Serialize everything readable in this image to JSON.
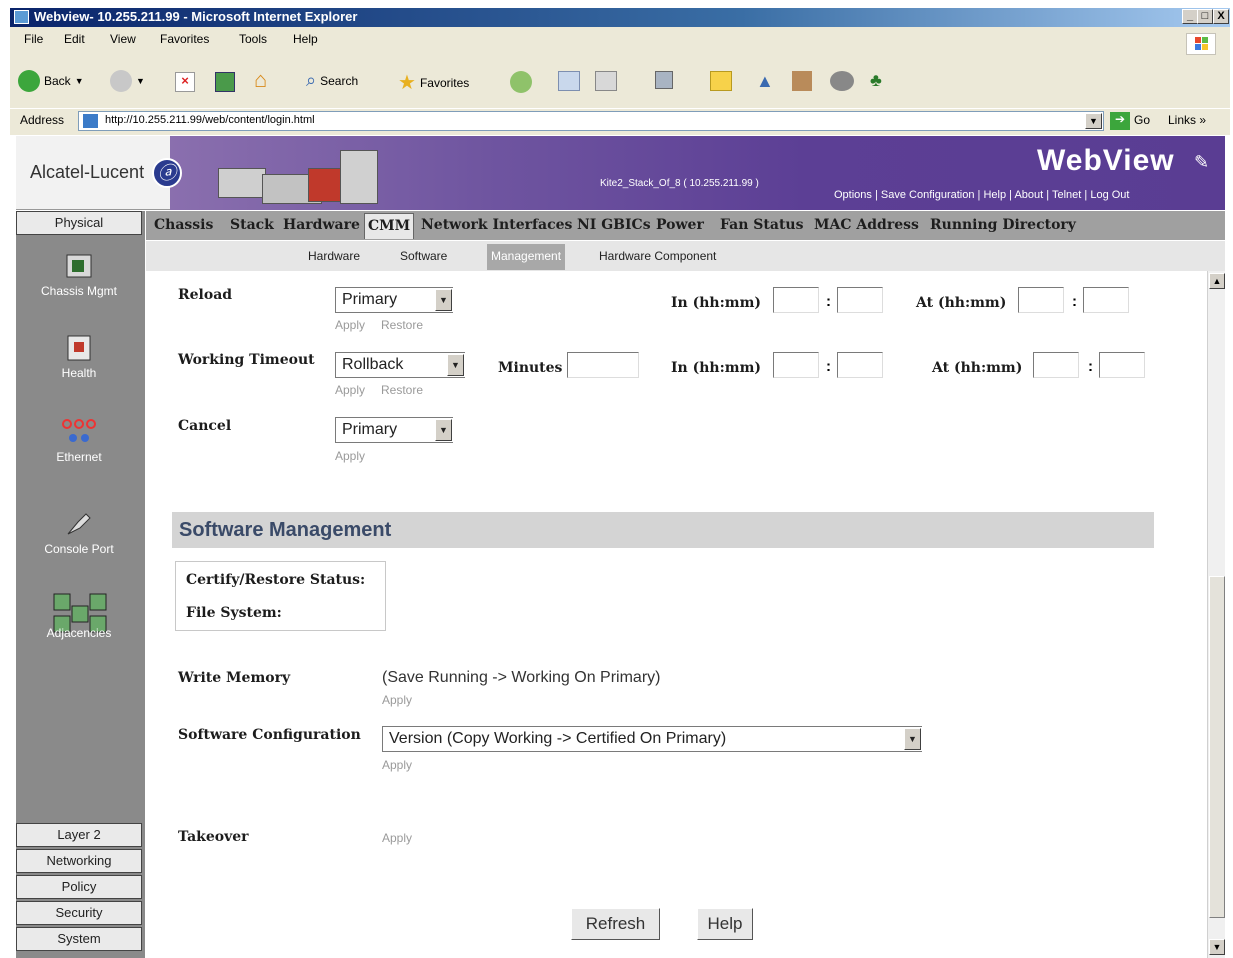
{
  "window": {
    "title": "Webview- 10.255.211.99 - Microsoft Internet Explorer",
    "min": "_",
    "max": "□",
    "close": "X"
  },
  "menu": [
    "File",
    "Edit",
    "View",
    "Favorites",
    "Tools",
    "Help"
  ],
  "toolbar": {
    "back": "Back",
    "search": "Search",
    "favorites": "Favorites"
  },
  "address": {
    "label": "Address",
    "url": "http://10.255.211.99/web/content/login.html",
    "go": "Go",
    "links": "Links »"
  },
  "header": {
    "brand": "Alcatel-Lucent",
    "system_name": "Kite2_Stack_Of_8  ( 10.255.211.99 )",
    "product_title": "WebView",
    "links": [
      "Options",
      "Save Configuration",
      "Help",
      "About",
      "Telnet",
      "Log Out"
    ]
  },
  "tabs": [
    "Chassis",
    "Stack",
    "Hardware",
    "CMM",
    "Network Interfaces",
    "NI GBICs",
    "Power",
    "Fan Status",
    "MAC Address",
    "Running Directory"
  ],
  "subtabs": [
    "Hardware",
    "Software",
    "Management",
    "Hardware Component"
  ],
  "leftnav": {
    "top_header": "Physical",
    "items": [
      "Chassis Mgmt",
      "Health",
      "Ethernet",
      "Console Port",
      "Adjacencies"
    ],
    "bottom_headers": [
      "Layer 2",
      "Networking",
      "Policy",
      "Security",
      "System"
    ]
  },
  "form": {
    "reload": {
      "label": "Reload",
      "select": "Primary",
      "apply": "Apply",
      "restore": "Restore",
      "in_label": "In (hh:mm)",
      "at_label": "At (hh:mm)"
    },
    "working_timeout": {
      "label": "Working Timeout",
      "select": "Rollback",
      "apply": "Apply",
      "restore": "Restore",
      "minutes_label": "Minutes",
      "in_label": "In (hh:mm)",
      "at_label": "At (hh:mm)"
    },
    "cancel": {
      "label": "Cancel",
      "select": "Primary",
      "apply": "Apply"
    },
    "colon": ":"
  },
  "software_management": {
    "title": "Software Management",
    "certify_status_label": "Certify/Restore Status:",
    "file_system_label": "File System:",
    "write_memory": {
      "label": "Write Memory",
      "desc": "(Save Running -> Working On Primary)",
      "apply": "Apply"
    },
    "software_configuration": {
      "label": "Software Configuration",
      "select": "Version (Copy Working -> Certified On Primary)",
      "apply": "Apply"
    },
    "takeover": {
      "label": "Takeover",
      "apply": "Apply"
    }
  },
  "buttons": {
    "refresh": "Refresh",
    "help": "Help"
  }
}
